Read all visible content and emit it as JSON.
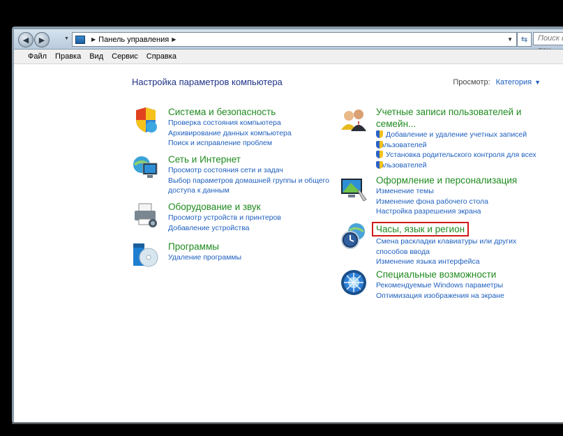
{
  "addressbar": {
    "path_root": "Панель управления",
    "search_placeholder": "Поиск в пан"
  },
  "menu": [
    "Файл",
    "Правка",
    "Вид",
    "Сервис",
    "Справка"
  ],
  "page": {
    "title": "Настройка параметров компьютера",
    "view_label": "Просмотр:",
    "view_value": "Категория"
  },
  "left": [
    {
      "title": "Система и безопасность",
      "links": [
        "Проверка состояния компьютера",
        "Архивирование данных компьютера",
        "Поиск и исправление проблем"
      ]
    },
    {
      "title": "Сеть и Интернет",
      "links": [
        "Просмотр состояния сети и задач",
        "Выбор параметров домашней группы и общего",
        "доступа к данным"
      ]
    },
    {
      "title": "Оборудование и звук",
      "links": [
        "Просмотр устройств и принтеров",
        "Добавление устройства"
      ]
    },
    {
      "title": "Программы",
      "links": [
        "Удаление программы"
      ]
    }
  ],
  "right": [
    {
      "title_line1": "Учетные записи пользователей и",
      "title_line2": "семейн...",
      "links": [
        "Добавление и удаление учетных записей",
        "пользователей",
        "Установка родительского контроля для всех",
        "пользователей"
      ]
    },
    {
      "title": "Оформление и персонализация",
      "links": [
        "Изменение темы",
        "Изменение фона рабочего стола",
        "Настройка разрешения экрана"
      ]
    },
    {
      "title": "Часы, язык и регион",
      "links": [
        "Смена раскладки клавиатуры или других",
        "способов ввода",
        "Изменение языка интерфейса"
      ]
    },
    {
      "title": "Специальные возможности",
      "links": [
        "Рекомендуемые Windows параметры",
        "Оптимизация изображения на экране"
      ]
    }
  ],
  "colors": {
    "heading": "#1f8a1f",
    "link": "#1e5fbf",
    "title": "#1e3287",
    "highlight": "#d01818"
  }
}
